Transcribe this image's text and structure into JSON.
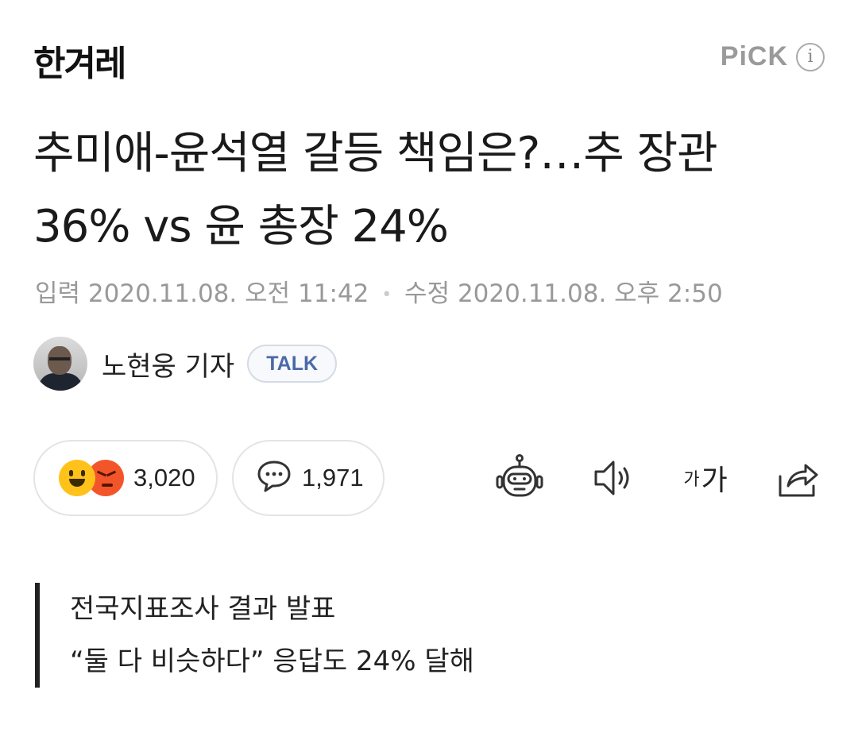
{
  "press": {
    "name": "한겨레"
  },
  "pick": {
    "label": "PiCK",
    "info": "i"
  },
  "article": {
    "headline": "추미애-윤석열 갈등 책임은?…추 장관 36% vs 윤 총장 24%",
    "input_label": "입력",
    "input_time": "2020.11.08. 오전 11:42",
    "separator": "•",
    "edit_label": "수정",
    "edit_time": "2020.11.08. 오후 2:50"
  },
  "reporter": {
    "name": "노현웅 기자",
    "talk": "TALK"
  },
  "actions": {
    "reactions": "3,020",
    "comments": "1,971",
    "font_size_small": "가",
    "font_size_large": "가"
  },
  "summary": {
    "line1": "전국지표조사 결과 발표",
    "line2": "“둘 다 비슷하다” 응답도 24% 달해"
  },
  "icons": [
    "happy-emoji-icon",
    "angry-emoji-icon",
    "comment-icon",
    "robot-summary-icon",
    "speaker-icon",
    "font-size-icon",
    "share-icon",
    "info-icon"
  ]
}
